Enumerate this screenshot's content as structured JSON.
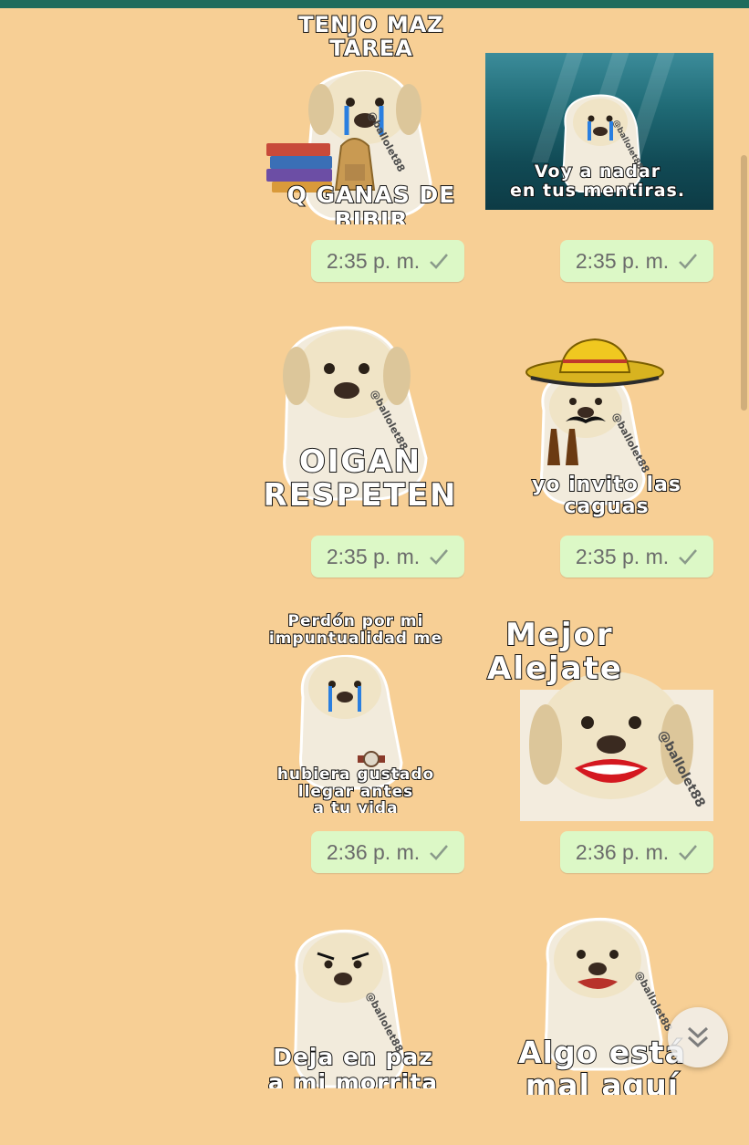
{
  "app": {
    "theme_color": "#1f6b5c",
    "bubble_color": "#dcf8c6",
    "wallpaper_color": "#f7cf95"
  },
  "watermark": "@ballolet88",
  "messages": [
    {
      "caption_top": [
        "TENJO MAZ",
        "TAREA"
      ],
      "caption_bottom": [
        "Q GANAS DE",
        "BIBIR"
      ],
      "time": "2:35 p. m.",
      "extras": [
        "tears",
        "books",
        "backpack"
      ]
    },
    {
      "caption_top": [],
      "caption_bottom": [
        "Voy a nadar",
        "en tus mentiras."
      ],
      "time": "2:35 p. m.",
      "extras": [
        "tears",
        "ocean"
      ]
    },
    {
      "caption_top": [],
      "caption_bottom": [
        "OIGAN",
        "RESPETEN"
      ],
      "time": "2:35 p. m.",
      "extras": []
    },
    {
      "caption_top": [],
      "caption_bottom": [
        "yo invito las",
        "caguas"
      ],
      "time": "2:35 p. m.",
      "extras": [
        "sombrero",
        "mustache",
        "beer"
      ]
    },
    {
      "caption_top": [
        "Perdón por mi",
        "impuntualidad me"
      ],
      "caption_bottom": [
        "hubiera gustado",
        "llegar antes",
        "a tu vida"
      ],
      "time": "2:36 p. m.",
      "extras": [
        "tears",
        "watch"
      ]
    },
    {
      "caption_top": [
        "Mejor",
        "Alejate"
      ],
      "caption_bottom": [],
      "time": "2:36 p. m.",
      "extras": [
        "lips"
      ]
    },
    {
      "caption_top": [],
      "caption_bottom": [
        "Deja en paz",
        "a mi morrita"
      ],
      "time": "",
      "extras": [
        "angry-brows"
      ]
    },
    {
      "caption_top": [],
      "caption_bottom": [
        "Algo está",
        "mal aquí"
      ],
      "time": "",
      "extras": [
        "lips-closed"
      ]
    }
  ],
  "icons": {
    "read_receipt": "check-icon",
    "scroll_down": "double-chevron-down-icon"
  }
}
